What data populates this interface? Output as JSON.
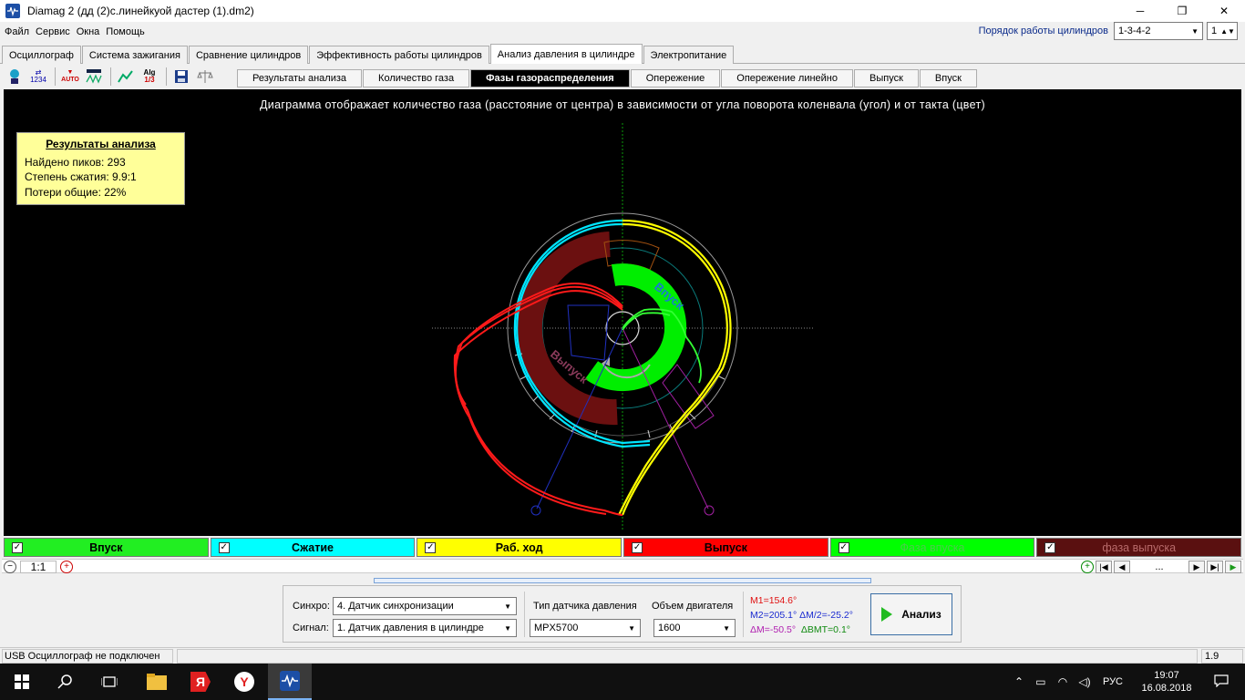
{
  "window": {
    "title": "Diamag 2 (дд (2)с.линейкуой дастер (1).dm2)",
    "minimize": "─",
    "maximize": "❐",
    "close": "✕"
  },
  "menu": [
    "Файл",
    "Сервис",
    "Окна",
    "Помощь"
  ],
  "cylinder_order": {
    "label": "Порядок работы цилиндров",
    "order_value": "1-3-4-2",
    "cylinder_value": "1"
  },
  "main_tabs": [
    {
      "label": "Осциллограф"
    },
    {
      "label": "Система зажигания"
    },
    {
      "label": "Сравнение цилиндров"
    },
    {
      "label": "Эффективность работы цилиндров"
    },
    {
      "label": "Анализ давления в цилиндре"
    },
    {
      "label": "Электропитание"
    }
  ],
  "toolbar": {
    "icons": [
      "sensor-icon",
      "scale-1234-icon",
      "trigger-auto-icon",
      "waveform-icon",
      "graph-icon",
      "algorithm-icon",
      "save-icon",
      "balance-icon"
    ],
    "auto_label": "AUTO",
    "num_label": "1234",
    "alg_label": "Alg",
    "alg_sub": "1/3"
  },
  "sub_tabs": [
    {
      "label": "Результаты анализа"
    },
    {
      "label": "Количество газа"
    },
    {
      "label": "Фазы газораспределения"
    },
    {
      "label": "Опережение"
    },
    {
      "label": "Опережение линейно"
    },
    {
      "label": "Выпуск"
    },
    {
      "label": "Впуск"
    }
  ],
  "plot": {
    "caption": "Диаграмма отображает количество газа (расстояние от центра) в зависимости от угла поворота коленвала (угол) и от такта (цвет)",
    "results": {
      "title": "Результаты анализа",
      "peaks": "Найдено пиков: 293",
      "compression": "Степень сжатия: 9.9:1",
      "losses": "Потери общие: 22%"
    },
    "ring_label_intake": "Впуск",
    "ring_label_exhaust": "Выпуск"
  },
  "colors": {
    "intake": "#00ff00",
    "compression": "#00ffff",
    "power": "#ffff00",
    "exhaust": "#ff0000",
    "intake_phase": "#00ee00",
    "exhaust_phase": "#6b1010"
  },
  "legend": [
    {
      "label": "Впуск",
      "color": "#22ee22",
      "text_color": "#000000"
    },
    {
      "label": "Сжатие",
      "color": "#00ffff",
      "text_color": "#000000"
    },
    {
      "label": "Раб. ход",
      "color": "#ffff00",
      "text_color": "#000000"
    },
    {
      "label": "Выпуск",
      "color": "#ff0000",
      "text_color": "#000000"
    },
    {
      "label": "Фаза впуска",
      "color": "#00ff00",
      "text_color": "#4ccb4c"
    },
    {
      "label": "фаза выпуска",
      "color": "#5a1010",
      "text_color": "#b86a6a"
    }
  ],
  "zoom": {
    "level": "1:1",
    "dots": "..."
  },
  "controls": {
    "sync_label": "Синхро:",
    "sync_value": "4.  Датчик синхронизации",
    "signal_label": "Сигнал:",
    "signal_value": "1.  Датчик давления в цилиндре",
    "sensor_type_label": "Тип датчика давления",
    "sensor_type_value": "MPX5700",
    "engine_volume_label": "Объем двигателя",
    "engine_volume_value": "1600",
    "m1": "M1=154.6°",
    "m2": "M2=205.1°",
    "dm2": "ΔM/2=-25.2°",
    "dm": "ΔM=-50.5°",
    "dbmt": "ΔВМТ=0.1°",
    "analyze_button": "Анализ"
  },
  "status": {
    "usb": "USB Осциллограф не подключен",
    "version": "1.9"
  },
  "taskbar": {
    "language": "РУС",
    "time": "19:07",
    "date": "16.08.2018"
  }
}
